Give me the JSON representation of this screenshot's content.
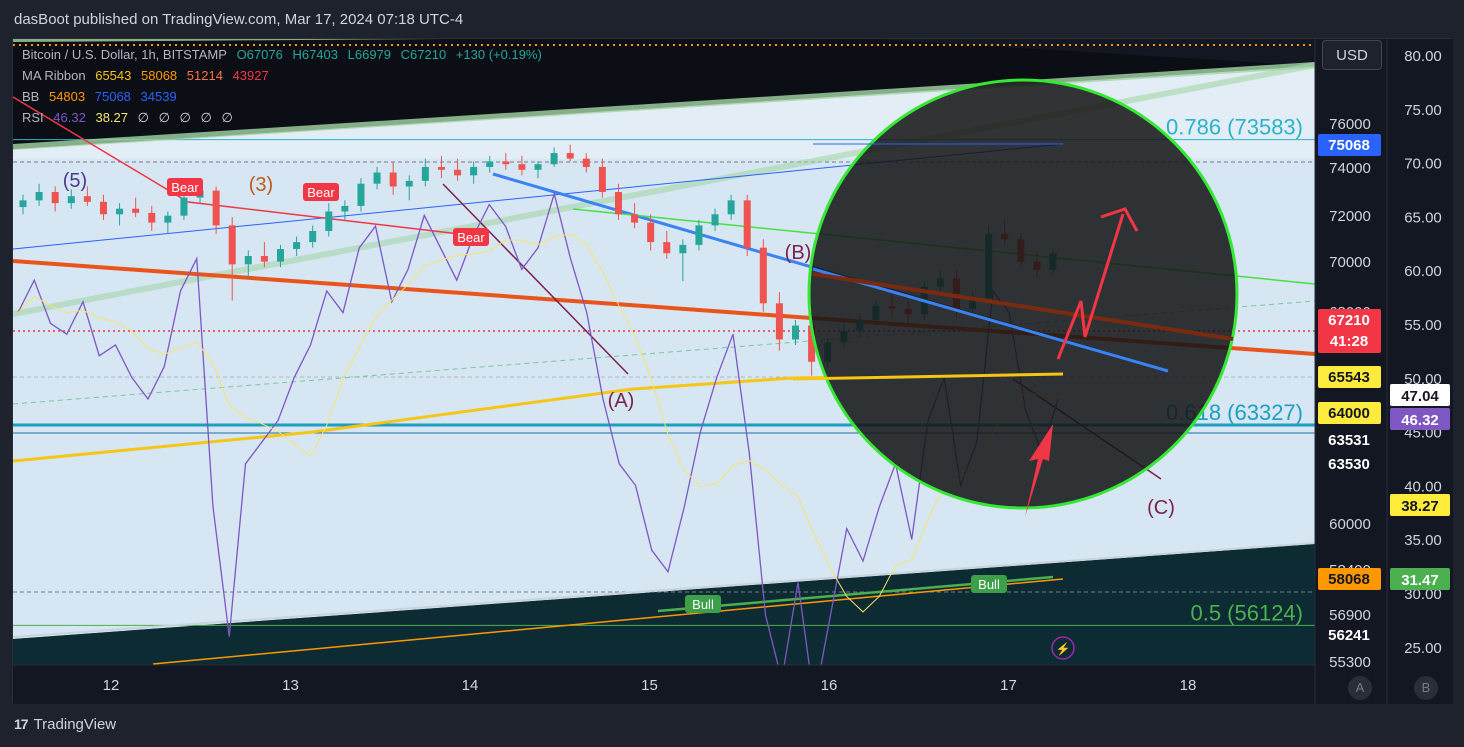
{
  "header": {
    "publisher_text": "dasBoot published on TradingView.com, Mar 17, 2024 07:18 UTC-4"
  },
  "footer": {
    "brand": "TradingView",
    "logo_glyph": "17"
  },
  "currency_button": "USD",
  "scale_buttons": [
    "A",
    "B"
  ],
  "legend": {
    "symbol": {
      "label": "Bitcoin / U.S. Dollar, 1h, BITSTAMP",
      "open": "O67076",
      "high": "H67403",
      "low": "L66979",
      "close": "C67210",
      "change": "+130 (+0.19%)"
    },
    "ma_ribbon": {
      "label": "MA Ribbon",
      "values": [
        "65543",
        "58068",
        "51214",
        "43927"
      ]
    },
    "bb": {
      "label": "BB",
      "values": [
        "54803",
        "75068",
        "34539"
      ]
    },
    "rsi": {
      "label": "RSI",
      "values": [
        "46.32",
        "38.27",
        "∅",
        "∅",
        "∅",
        "∅",
        "∅"
      ]
    }
  },
  "colors": {
    "background": "#131722",
    "bull": "#26a69a",
    "bear": "#ef5350",
    "ma_fast": "#f5c518",
    "ma_slow": "#ff9800",
    "rsi": "#7e57c2",
    "rsi_ma": "#f7e46d",
    "bb_basis": "#2962ff",
    "channel": "#a5d6a7",
    "fib_786": "#2ab3c9",
    "fib_618": "#1e9fc2",
    "fib_50": "#4caf50",
    "circle": "#34e834"
  },
  "chart_data": {
    "type": "candlestick",
    "symbol": "Bitcoin / U.S. Dollar",
    "timeframe": "1h",
    "exchange": "BITSTAMP",
    "x_ticks": [
      "12",
      "13",
      "14",
      "15",
      "16",
      "17",
      "18"
    ],
    "price_axis": {
      "ticks": [
        "76000",
        "74000",
        "72000",
        "70000",
        "68000",
        "60000",
        "58400",
        "56900",
        "55300"
      ],
      "ylim": [
        54700,
        77200
      ],
      "labels": [
        {
          "text": "75068",
          "bg": "#2962ff",
          "fg": "#ffffff",
          "value": 75068
        },
        {
          "text": "67210",
          "sub": "41:28",
          "bg": "#f23645",
          "fg": "#ffffff",
          "value": 67210
        },
        {
          "text": "65543",
          "bg": "#ffeb3b",
          "fg": "#131722",
          "value": 65543
        },
        {
          "text": "64000",
          "bg": "#ffeb3b",
          "fg": "#131722",
          "value": 64000
        },
        {
          "text": "63531",
          "bg": "",
          "fg": "#ffffff",
          "value": 63531
        },
        {
          "text": "63530",
          "bg": "",
          "fg": "#ffffff",
          "value": 63530
        },
        {
          "text": "58068",
          "bg": "#ff9800",
          "fg": "#131722",
          "value": 58068
        },
        {
          "text": "56241",
          "bg": "",
          "fg": "#ffffff",
          "value": 56241
        }
      ]
    },
    "rsi_axis": {
      "ticks": [
        "80.00",
        "75.00",
        "70.00",
        "65.00",
        "60.00",
        "55.00",
        "50.00",
        "45.00",
        "40.00",
        "35.00",
        "30.00",
        "25.00"
      ],
      "labels": [
        {
          "text": "47.04",
          "bg": "#ffffff",
          "fg": "#131722"
        },
        {
          "text": "46.32",
          "bg": "#7e57c2",
          "fg": "#ffffff"
        },
        {
          "text": "38.27",
          "bg": "#ffeb3b",
          "fg": "#131722"
        },
        {
          "text": "31.47",
          "bg": "#4caf50",
          "fg": "#ffffff"
        }
      ]
    },
    "fib_levels": [
      {
        "label": "0.786 (73583)",
        "price": 73583
      },
      {
        "label": "0.618 (63327)",
        "price": 63327
      },
      {
        "label": "0.5 (56124)",
        "price": 56124
      }
    ],
    "wave_labels": [
      "(5)",
      "(3)",
      "(B)",
      "(A)",
      "(C)"
    ],
    "signals": [
      "Bear",
      "Bear",
      "Bear",
      "Bull",
      "Bull"
    ],
    "candles": [
      [
        71160,
        71600,
        70900,
        71400
      ],
      [
        71400,
        72000,
        71200,
        71700
      ],
      [
        71700,
        71900,
        71000,
        71300
      ],
      [
        71300,
        71800,
        71100,
        71550
      ],
      [
        71550,
        71900,
        71200,
        71350
      ],
      [
        71350,
        71600,
        70700,
        70900
      ],
      [
        70900,
        71300,
        70500,
        71100
      ],
      [
        71100,
        71500,
        70800,
        70950
      ],
      [
        70950,
        71200,
        70300,
        70600
      ],
      [
        70600,
        71000,
        70200,
        70850
      ],
      [
        70850,
        71700,
        70700,
        71500
      ],
      [
        71500,
        72000,
        71300,
        71750
      ],
      [
        71750,
        71900,
        70200,
        70500
      ],
      [
        70500,
        70800,
        67800,
        69100
      ],
      [
        69100,
        69600,
        68600,
        69400
      ],
      [
        69400,
        69900,
        69000,
        69200
      ],
      [
        69200,
        69800,
        69000,
        69650
      ],
      [
        69650,
        70100,
        69400,
        69900
      ],
      [
        69900,
        70500,
        69700,
        70300
      ],
      [
        70300,
        71300,
        70100,
        71000
      ],
      [
        71000,
        71400,
        70700,
        71200
      ],
      [
        71200,
        72200,
        71000,
        72000
      ],
      [
        72000,
        72600,
        71800,
        72400
      ],
      [
        72400,
        72800,
        71600,
        71900
      ],
      [
        71900,
        72300,
        71400,
        72100
      ],
      [
        72100,
        72900,
        71900,
        72600
      ],
      [
        72600,
        73000,
        72200,
        72500
      ],
      [
        72500,
        72900,
        72100,
        72300
      ],
      [
        72300,
        72800,
        72000,
        72600
      ],
      [
        72600,
        73000,
        72400,
        72800
      ],
      [
        72800,
        73100,
        72500,
        72700
      ],
      [
        72700,
        73000,
        72300,
        72500
      ],
      [
        72500,
        72800,
        72200,
        72700
      ],
      [
        72700,
        73300,
        72600,
        73100
      ],
      [
        73100,
        73400,
        72800,
        72900
      ],
      [
        72900,
        73100,
        72400,
        72600
      ],
      [
        72600,
        72900,
        71500,
        71700
      ],
      [
        71700,
        72000,
        70700,
        70900
      ],
      [
        70900,
        71300,
        70400,
        70600
      ],
      [
        70600,
        70900,
        69600,
        69900
      ],
      [
        69900,
        70300,
        69300,
        69500
      ],
      [
        69500,
        70000,
        68500,
        69800
      ],
      [
        69800,
        70700,
        69600,
        70500
      ],
      [
        70500,
        71100,
        70300,
        70900
      ],
      [
        70900,
        71600,
        70700,
        71400
      ],
      [
        71400,
        71600,
        69400,
        69700
      ],
      [
        69700,
        70000,
        67400,
        67700
      ],
      [
        67700,
        68100,
        66000,
        66400
      ],
      [
        66400,
        67100,
        66200,
        66900
      ],
      [
        66900,
        67400,
        65100,
        65600
      ],
      [
        65600,
        66500,
        65400,
        66300
      ],
      [
        66300,
        67000,
        66100,
        66700
      ],
      [
        66700,
        67300,
        66500,
        67100
      ],
      [
        67100,
        67800,
        66900,
        67600
      ],
      [
        67600,
        68000,
        67200,
        67500
      ],
      [
        67500,
        67800,
        66900,
        67300
      ],
      [
        67300,
        68500,
        67100,
        68300
      ],
      [
        68300,
        68900,
        68100,
        68600
      ],
      [
        68600,
        68900,
        67200,
        67500
      ],
      [
        67500,
        68100,
        67300,
        67900
      ],
      [
        67900,
        70500,
        67700,
        70200
      ],
      [
        70200,
        70700,
        69800,
        70000
      ],
      [
        70000,
        70200,
        69000,
        69200
      ],
      [
        69200,
        69600,
        68600,
        68900
      ],
      [
        68900,
        69700,
        68700,
        69500
      ]
    ],
    "rsi_series": [
      58,
      61,
      57,
      56,
      59,
      54,
      55,
      52,
      50,
      53,
      60,
      63,
      40,
      28,
      44,
      46,
      48,
      52,
      55,
      60,
      58,
      64,
      66,
      59,
      62,
      67,
      64,
      61,
      65,
      68,
      66,
      62,
      64,
      69,
      63,
      58,
      50,
      44,
      42,
      36,
      34,
      40,
      47,
      52,
      56,
      45,
      30,
      24,
      33,
      22,
      30,
      38,
      35,
      40,
      44,
      37,
      48,
      52,
      42,
      46,
      60,
      58,
      49,
      45,
      50
    ]
  }
}
